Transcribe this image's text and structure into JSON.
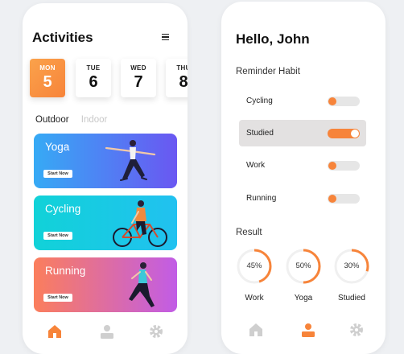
{
  "left_screen": {
    "title": "Activities",
    "dates": [
      {
        "day": "MON",
        "num": "5",
        "active": true
      },
      {
        "day": "TUE",
        "num": "6",
        "active": false
      },
      {
        "day": "WED",
        "num": "7",
        "active": false
      },
      {
        "day": "THU",
        "num": "8",
        "active": false
      }
    ],
    "tabs": [
      "Outdoor",
      "Indoor"
    ],
    "activities": [
      {
        "name": "Yoga",
        "button": "Start Now"
      },
      {
        "name": "Cycling",
        "button": "Start Now"
      },
      {
        "name": "Running",
        "button": "Start Now"
      }
    ],
    "nav": [
      "home-icon",
      "profile-icon",
      "settings-icon"
    ],
    "active_nav": "home-icon"
  },
  "right_screen": {
    "greeting": "Hello, John",
    "reminder_title": "Reminder Habit",
    "habits": [
      {
        "label": "Cycling",
        "on": false
      },
      {
        "label": "Studied",
        "on": true
      },
      {
        "label": "Work",
        "on": false
      },
      {
        "label": "Running",
        "on": false
      }
    ],
    "result_title": "Result",
    "results": [
      {
        "label": "Work",
        "percent": "45%",
        "value": 0.45
      },
      {
        "label": "Yoga",
        "percent": "50%",
        "value": 0.5
      },
      {
        "label": "Studied",
        "percent": "30%",
        "value": 0.3
      }
    ],
    "nav": [
      "home-icon",
      "profile-icon",
      "settings-icon"
    ],
    "active_nav": "profile-icon"
  },
  "colors": {
    "accent": "#f7843a",
    "nav_inactive": "#cfcfcf"
  }
}
